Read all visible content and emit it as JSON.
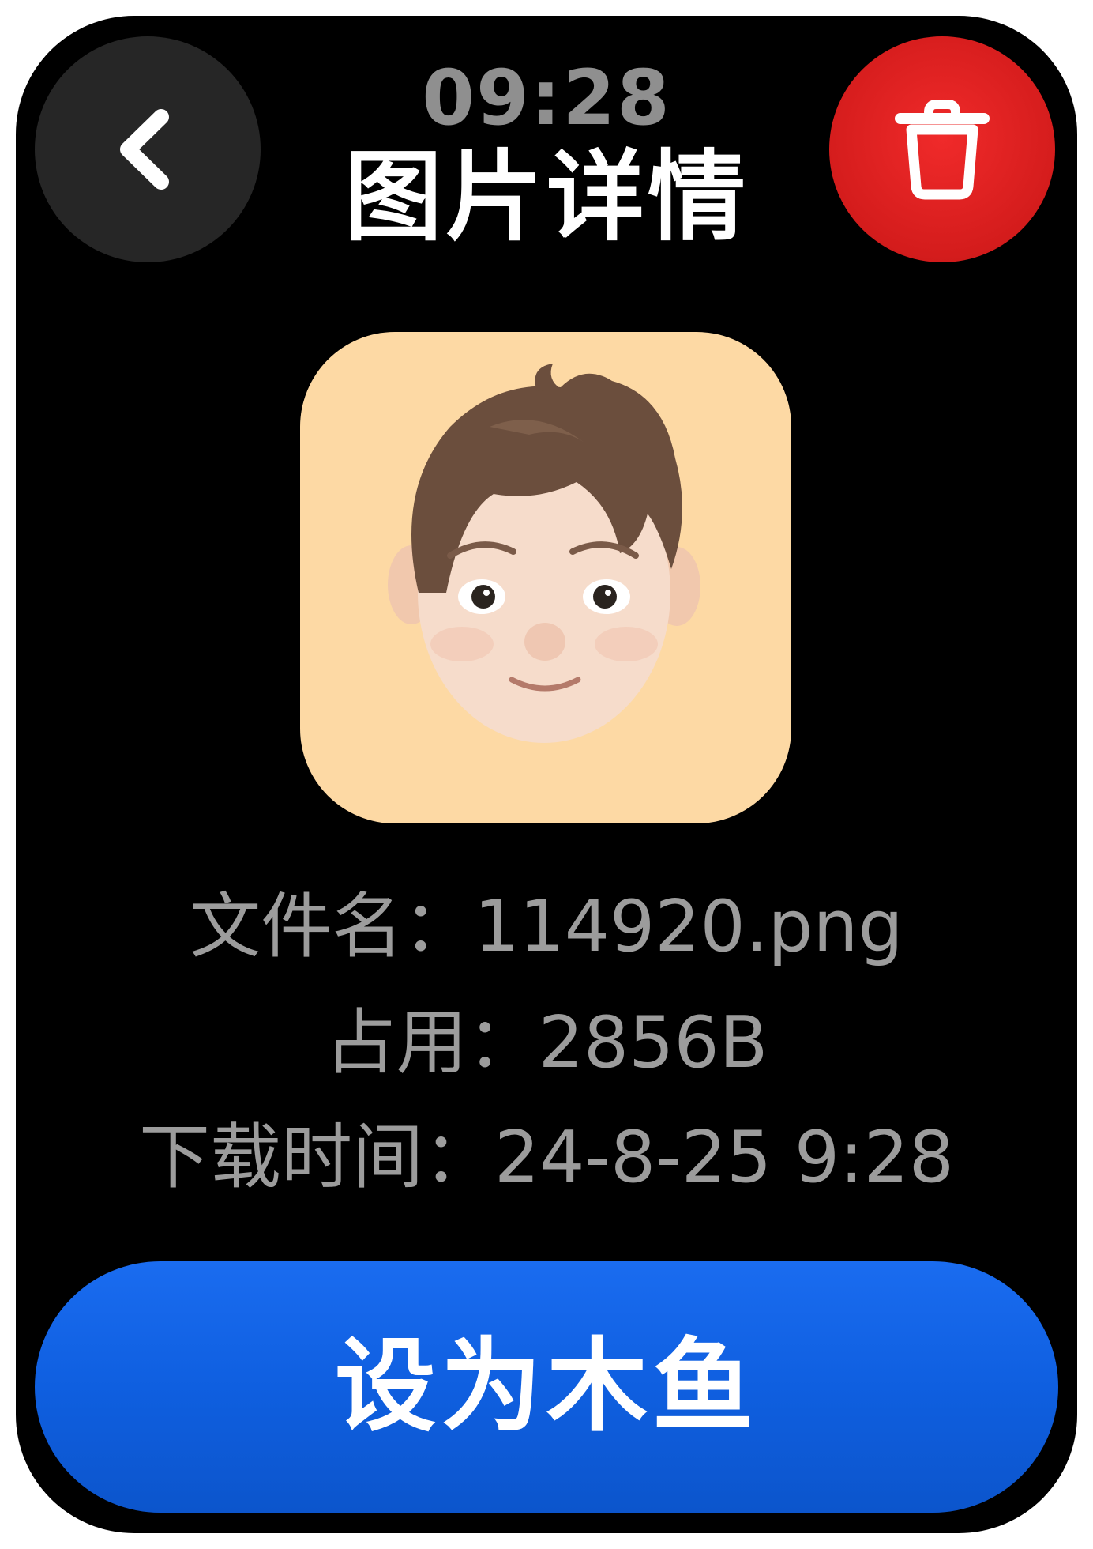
{
  "status_bar": {
    "time": "09:28"
  },
  "header": {
    "title": "图片详情",
    "back_icon": "chevron-left-icon",
    "delete_icon": "trash-icon"
  },
  "preview": {
    "image": "memoji avatar of a boy with brown hair"
  },
  "details": {
    "filename_label": "文件名：",
    "filename_value": "114920.png",
    "size_label": "占用：",
    "size_value": "2856B",
    "time_label": "下载时间：",
    "time_value": "24-8-25 9:28"
  },
  "action": {
    "label": "设为木鱼"
  },
  "colors": {
    "background": "#000000",
    "delete_button": "#e02020",
    "primary_button": "#0f5fe0",
    "preview_background": "#fdd9a4",
    "info_text": "#9c9c9c"
  }
}
